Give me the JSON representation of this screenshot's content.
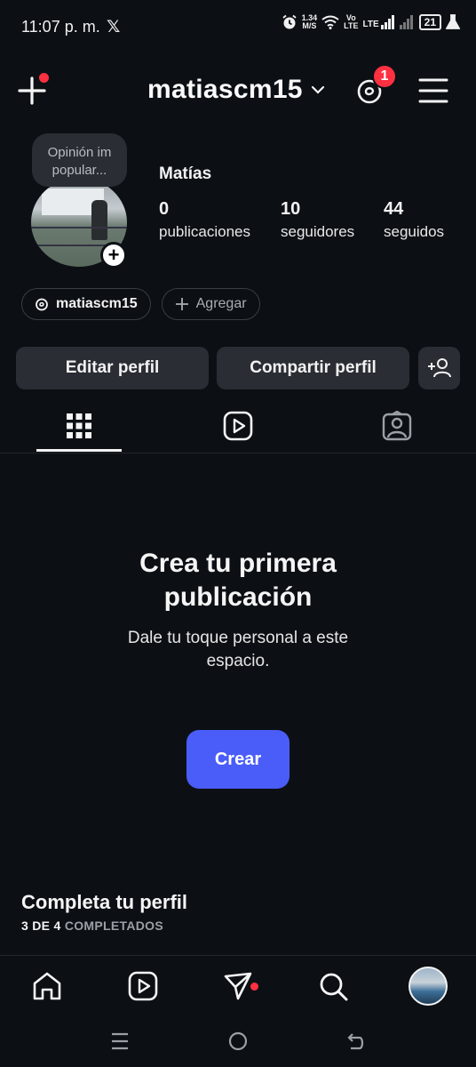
{
  "status_bar": {
    "time": "11:07 p. m.",
    "app_icon": "x-logo",
    "net_speed_value": "1.34",
    "net_speed_unit": "M/S",
    "volte_top": "Vo",
    "volte_bottom": "LTE",
    "lte": "LTE",
    "battery": "21",
    "icons": [
      "alarm-icon",
      "wifi-icon",
      "signal-icon",
      "signal-icon",
      "battery-icon",
      "flask-icon"
    ]
  },
  "header": {
    "username": "matiascm15",
    "notification_count": "1",
    "icons": [
      "plus-icon",
      "chevron-down-icon",
      "threads-icon",
      "hamburger-menu-icon"
    ]
  },
  "profile": {
    "note": "Opinión im popular...",
    "display_name": "Matías",
    "stats": [
      {
        "value": "0",
        "label": "publicaciones"
      },
      {
        "value": "10",
        "label": "seguidores"
      },
      {
        "value": "44",
        "label": "seguidos"
      }
    ],
    "chips": {
      "threads_handle": "matiascm15",
      "add_label": "Agregar"
    },
    "actions": {
      "edit": "Editar perfil",
      "share": "Compartir perfil"
    }
  },
  "tabs": [
    "grid-icon",
    "reels-icon",
    "tagged-icon"
  ],
  "empty_state": {
    "title_line1": "Crea tu primera",
    "title_line2": "publicación",
    "subtitle_line1": "Dale tu toque personal a este",
    "subtitle_line2": "espacio.",
    "button": "Crear"
  },
  "complete_profile": {
    "title": "Completa tu perfil",
    "progress_bold": "3 DE 4",
    "progress_muted": "COMPLETADOS"
  },
  "bottom_nav": [
    "home-icon",
    "reels-icon",
    "direct-icon",
    "search-icon",
    "profile-avatar"
  ],
  "colors": {
    "background": "#0c1015",
    "button_bg": "#2a2d33",
    "accent": "#4a5df9",
    "badge": "#ff3040"
  }
}
